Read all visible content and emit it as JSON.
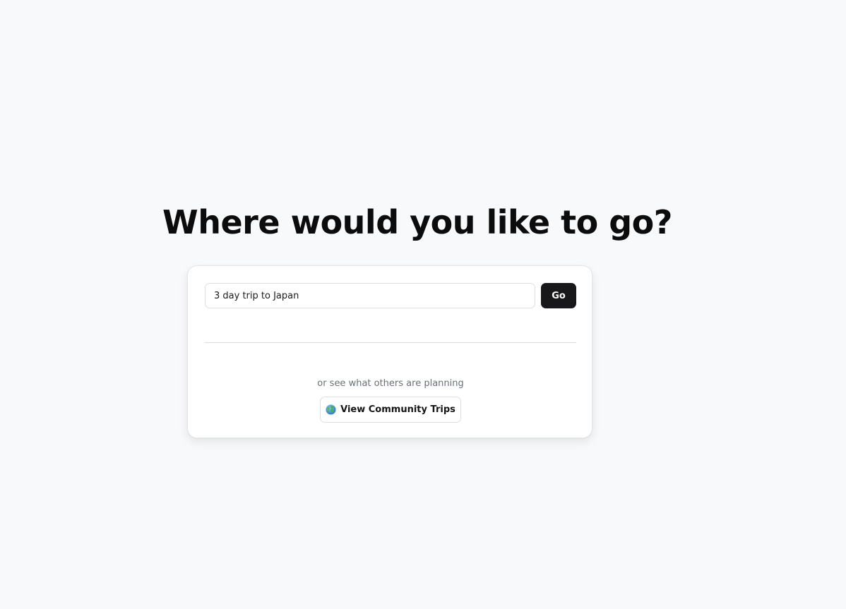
{
  "header": {
    "title": "Where would you like to go?"
  },
  "search": {
    "value": "3 day trip to Japan",
    "placeholder": "",
    "submit_label": "Go"
  },
  "community": {
    "prompt": "or see what others are planning",
    "button_icon": "globe-icon",
    "button_label": "View Community Trips"
  },
  "colors": {
    "background": "#f8f9fb",
    "card": "#ffffff",
    "primary_button": "#18181a",
    "muted_text": "#6b7078"
  }
}
